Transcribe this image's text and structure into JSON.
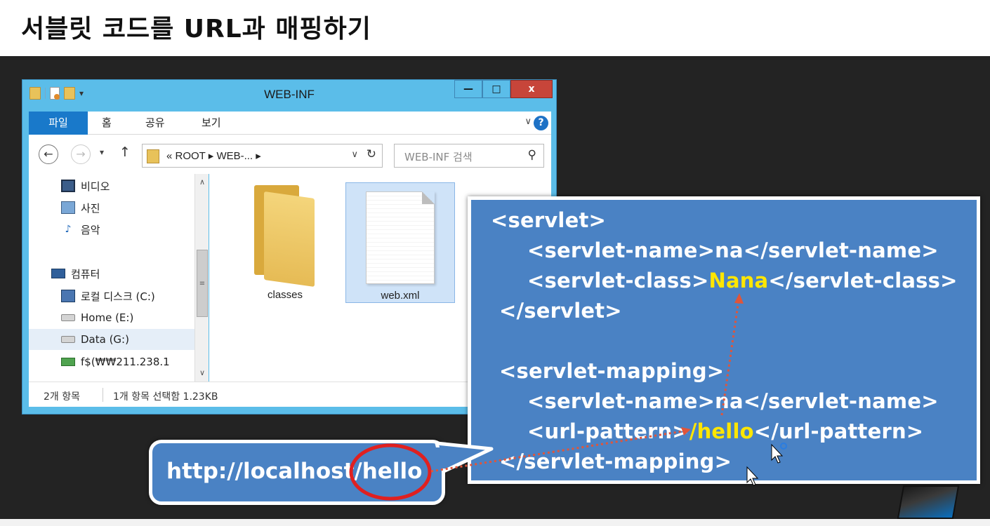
{
  "slide": {
    "title": "서블릿 코드를 URL과 매핑하기"
  },
  "window": {
    "title": "WEB-INF",
    "controls": {
      "minimize": "—",
      "maximize": "□",
      "close": "x"
    },
    "ribbon_tabs": [
      "파일",
      "홈",
      "공유",
      "보기"
    ],
    "help": "?",
    "address": {
      "prefix": "«",
      "path": "ROOT  ▸ WEB-...  ▸"
    },
    "search_placeholder": "WEB-INF 검색",
    "nav_pane": [
      {
        "label": "비디오",
        "icon": "video-icon"
      },
      {
        "label": "사진",
        "icon": "photo-icon"
      },
      {
        "label": "음악",
        "icon": "music-icon"
      },
      {
        "label": "컴퓨터",
        "icon": "computer-icon"
      },
      {
        "label": "로컬 디스크 (C:)",
        "icon": "local-disk-icon"
      },
      {
        "label": "Home (E:)",
        "icon": "drive-icon"
      },
      {
        "label": "Data (G:)",
        "icon": "drive-icon"
      },
      {
        "label": "f$(₩₩211.238.1",
        "icon": "network-drive-icon"
      }
    ],
    "files": [
      {
        "name": "classes",
        "type": "folder"
      },
      {
        "name": "web.xml",
        "type": "document"
      }
    ],
    "status": {
      "count": "2개 항목",
      "selection": "1개 항목 선택함 1.23KB"
    }
  },
  "code": {
    "lines": [
      {
        "pre": "<servlet>",
        "hl": "",
        "post": ""
      },
      {
        "pre": "<servlet-name>na</servlet-name>",
        "hl": "",
        "post": ""
      },
      {
        "pre": "<servlet-class>",
        "hl": "Nana",
        "post": "</servlet-class>"
      },
      {
        "pre": "</servlet>",
        "hl": "",
        "post": ""
      },
      {
        "pre": "<servlet-mapping>",
        "hl": "",
        "post": ""
      },
      {
        "pre": "<servlet-name>na</servlet-name>",
        "hl": "",
        "post": ""
      },
      {
        "pre": "<url-pattern>",
        "hl": "/hello",
        "post": "</url-pattern>"
      },
      {
        "pre": "</servlet-mapping>",
        "hl": "",
        "post": ""
      }
    ]
  },
  "callout": {
    "url": "http://localhost/hello"
  },
  "colors": {
    "highlight": "#ffe600",
    "panel": "#4a82c4",
    "accent_circle": "#e02020",
    "arrow": "#e0553a"
  }
}
